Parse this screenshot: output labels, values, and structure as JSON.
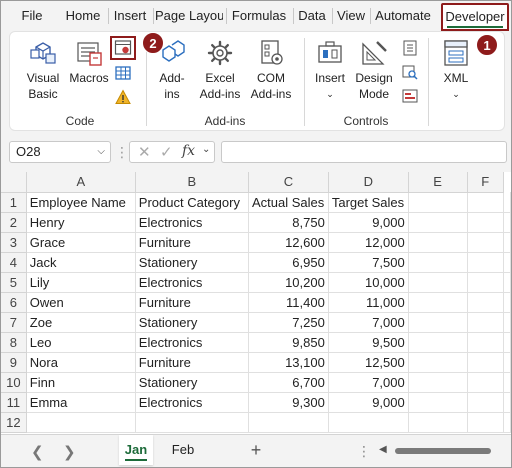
{
  "tabs": [
    "File",
    "Home",
    "Insert",
    "Page Layout",
    "Formulas",
    "Data",
    "View",
    "Automate",
    "Developer"
  ],
  "ribbon": {
    "code": {
      "label": "Code",
      "visual_basic": [
        "Visual",
        "Basic"
      ],
      "macros": "Macros"
    },
    "addins": {
      "label": "Add-ins",
      "addins_btn": [
        "Add-",
        "ins"
      ],
      "excel_addins": [
        "Excel",
        "Add-ins"
      ],
      "com_addins": [
        "COM",
        "Add-ins"
      ]
    },
    "controls": {
      "label": "Controls",
      "insert": "Insert",
      "design_mode": [
        "Design",
        "Mode"
      ]
    },
    "xml": {
      "label": "XML"
    }
  },
  "badges": {
    "one": "1",
    "two": "2"
  },
  "formula_bar": {
    "name_box": "O28",
    "fx": "fx",
    "formula": ""
  },
  "columns": [
    "A",
    "B",
    "C",
    "D",
    "E",
    "F"
  ],
  "rows": [
    {
      "n": "1",
      "cells": [
        "Employee Name",
        "Product Category",
        "Actual Sales",
        "Target Sales",
        "",
        ""
      ]
    },
    {
      "n": "2",
      "cells": [
        "Henry",
        "Electronics",
        "8,750",
        "9,000",
        "",
        ""
      ]
    },
    {
      "n": "3",
      "cells": [
        "Grace",
        "Furniture",
        "12,600",
        "12,000",
        "",
        ""
      ]
    },
    {
      "n": "4",
      "cells": [
        "Jack",
        "Stationery",
        "6,950",
        "7,500",
        "",
        ""
      ]
    },
    {
      "n": "5",
      "cells": [
        "Lily",
        "Electronics",
        "10,200",
        "10,000",
        "",
        ""
      ]
    },
    {
      "n": "6",
      "cells": [
        "Owen",
        "Furniture",
        "11,400",
        "11,000",
        "",
        ""
      ]
    },
    {
      "n": "7",
      "cells": [
        "Zoe",
        "Stationery",
        "7,250",
        "7,000",
        "",
        ""
      ]
    },
    {
      "n": "8",
      "cells": [
        "Leo",
        "Electronics",
        "9,850",
        "9,500",
        "",
        ""
      ]
    },
    {
      "n": "9",
      "cells": [
        "Nora",
        "Furniture",
        "13,100",
        "12,500",
        "",
        ""
      ]
    },
    {
      "n": "10",
      "cells": [
        "Finn",
        "Stationery",
        "6,700",
        "7,000",
        "",
        ""
      ]
    },
    {
      "n": "11",
      "cells": [
        "Emma",
        "Electronics",
        "9,300",
        "9,000",
        "",
        ""
      ]
    },
    {
      "n": "12",
      "cells": [
        "",
        "",
        "",
        "",
        "",
        ""
      ]
    }
  ],
  "sheets": {
    "active": "Jan",
    "other": "Feb",
    "add": "+"
  },
  "colors": {
    "accent": "#1d6b3a",
    "highlight": "#8e1b1b"
  }
}
